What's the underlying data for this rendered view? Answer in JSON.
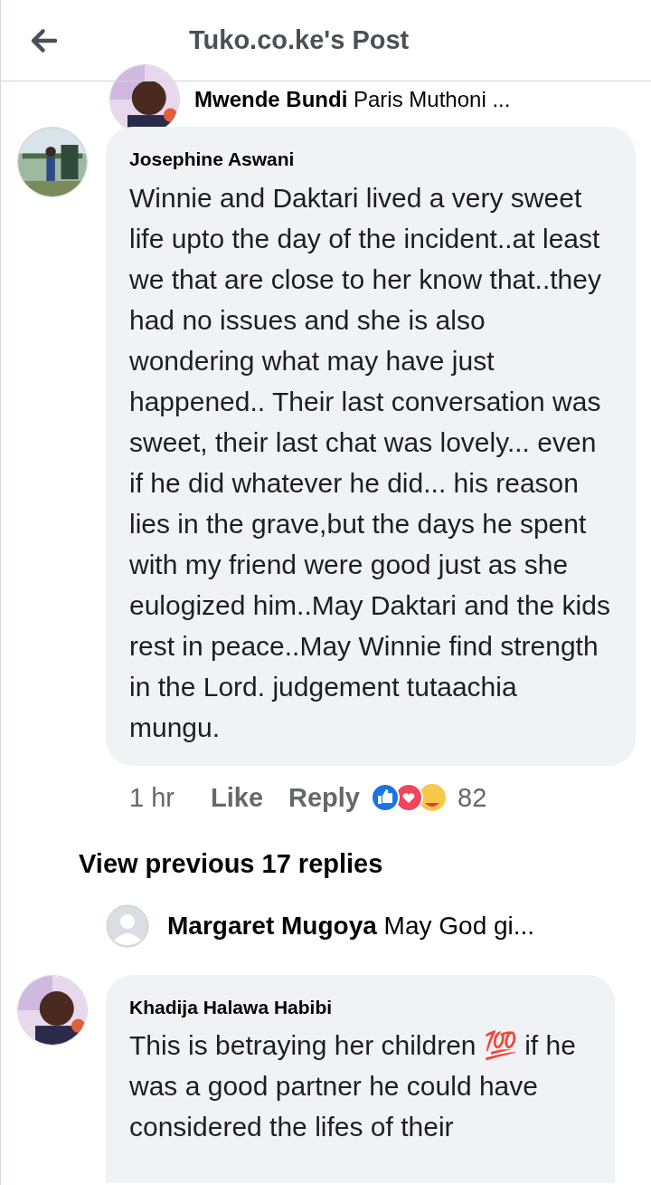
{
  "header": {
    "title": "Tuko.co.ke's Post"
  },
  "top_reply": {
    "author": "Mwende Bundi",
    "text": "Paris Muthoni ..."
  },
  "comments": [
    {
      "author": "Josephine Aswani",
      "text": "Winnie and Daktari lived a very sweet life upto the day of the incident..at least we that are close to her know that..they had no issues and she is also wondering what may have just happened.. Their last conversation was sweet, their last chat was lovely... even if he did whatever he did... his reason lies in the grave,but the days he spent with my friend were good just as she eulogized him..May Daktari and the kids rest in peace..May Winnie find strength in the Lord. judgement tutaachia mungu.",
      "time": "1 hr",
      "like": "Like",
      "reply": "Reply",
      "reaction_count": "82",
      "view_previous": "View previous 17 replies",
      "latest_reply": {
        "author": "Margaret Mugoya",
        "text": "May God gi..."
      }
    },
    {
      "author": "Khadija Halawa Habibi",
      "text": "This is betraying her children 💯 if he was a good partner he could have considered the lifes of their"
    }
  ]
}
